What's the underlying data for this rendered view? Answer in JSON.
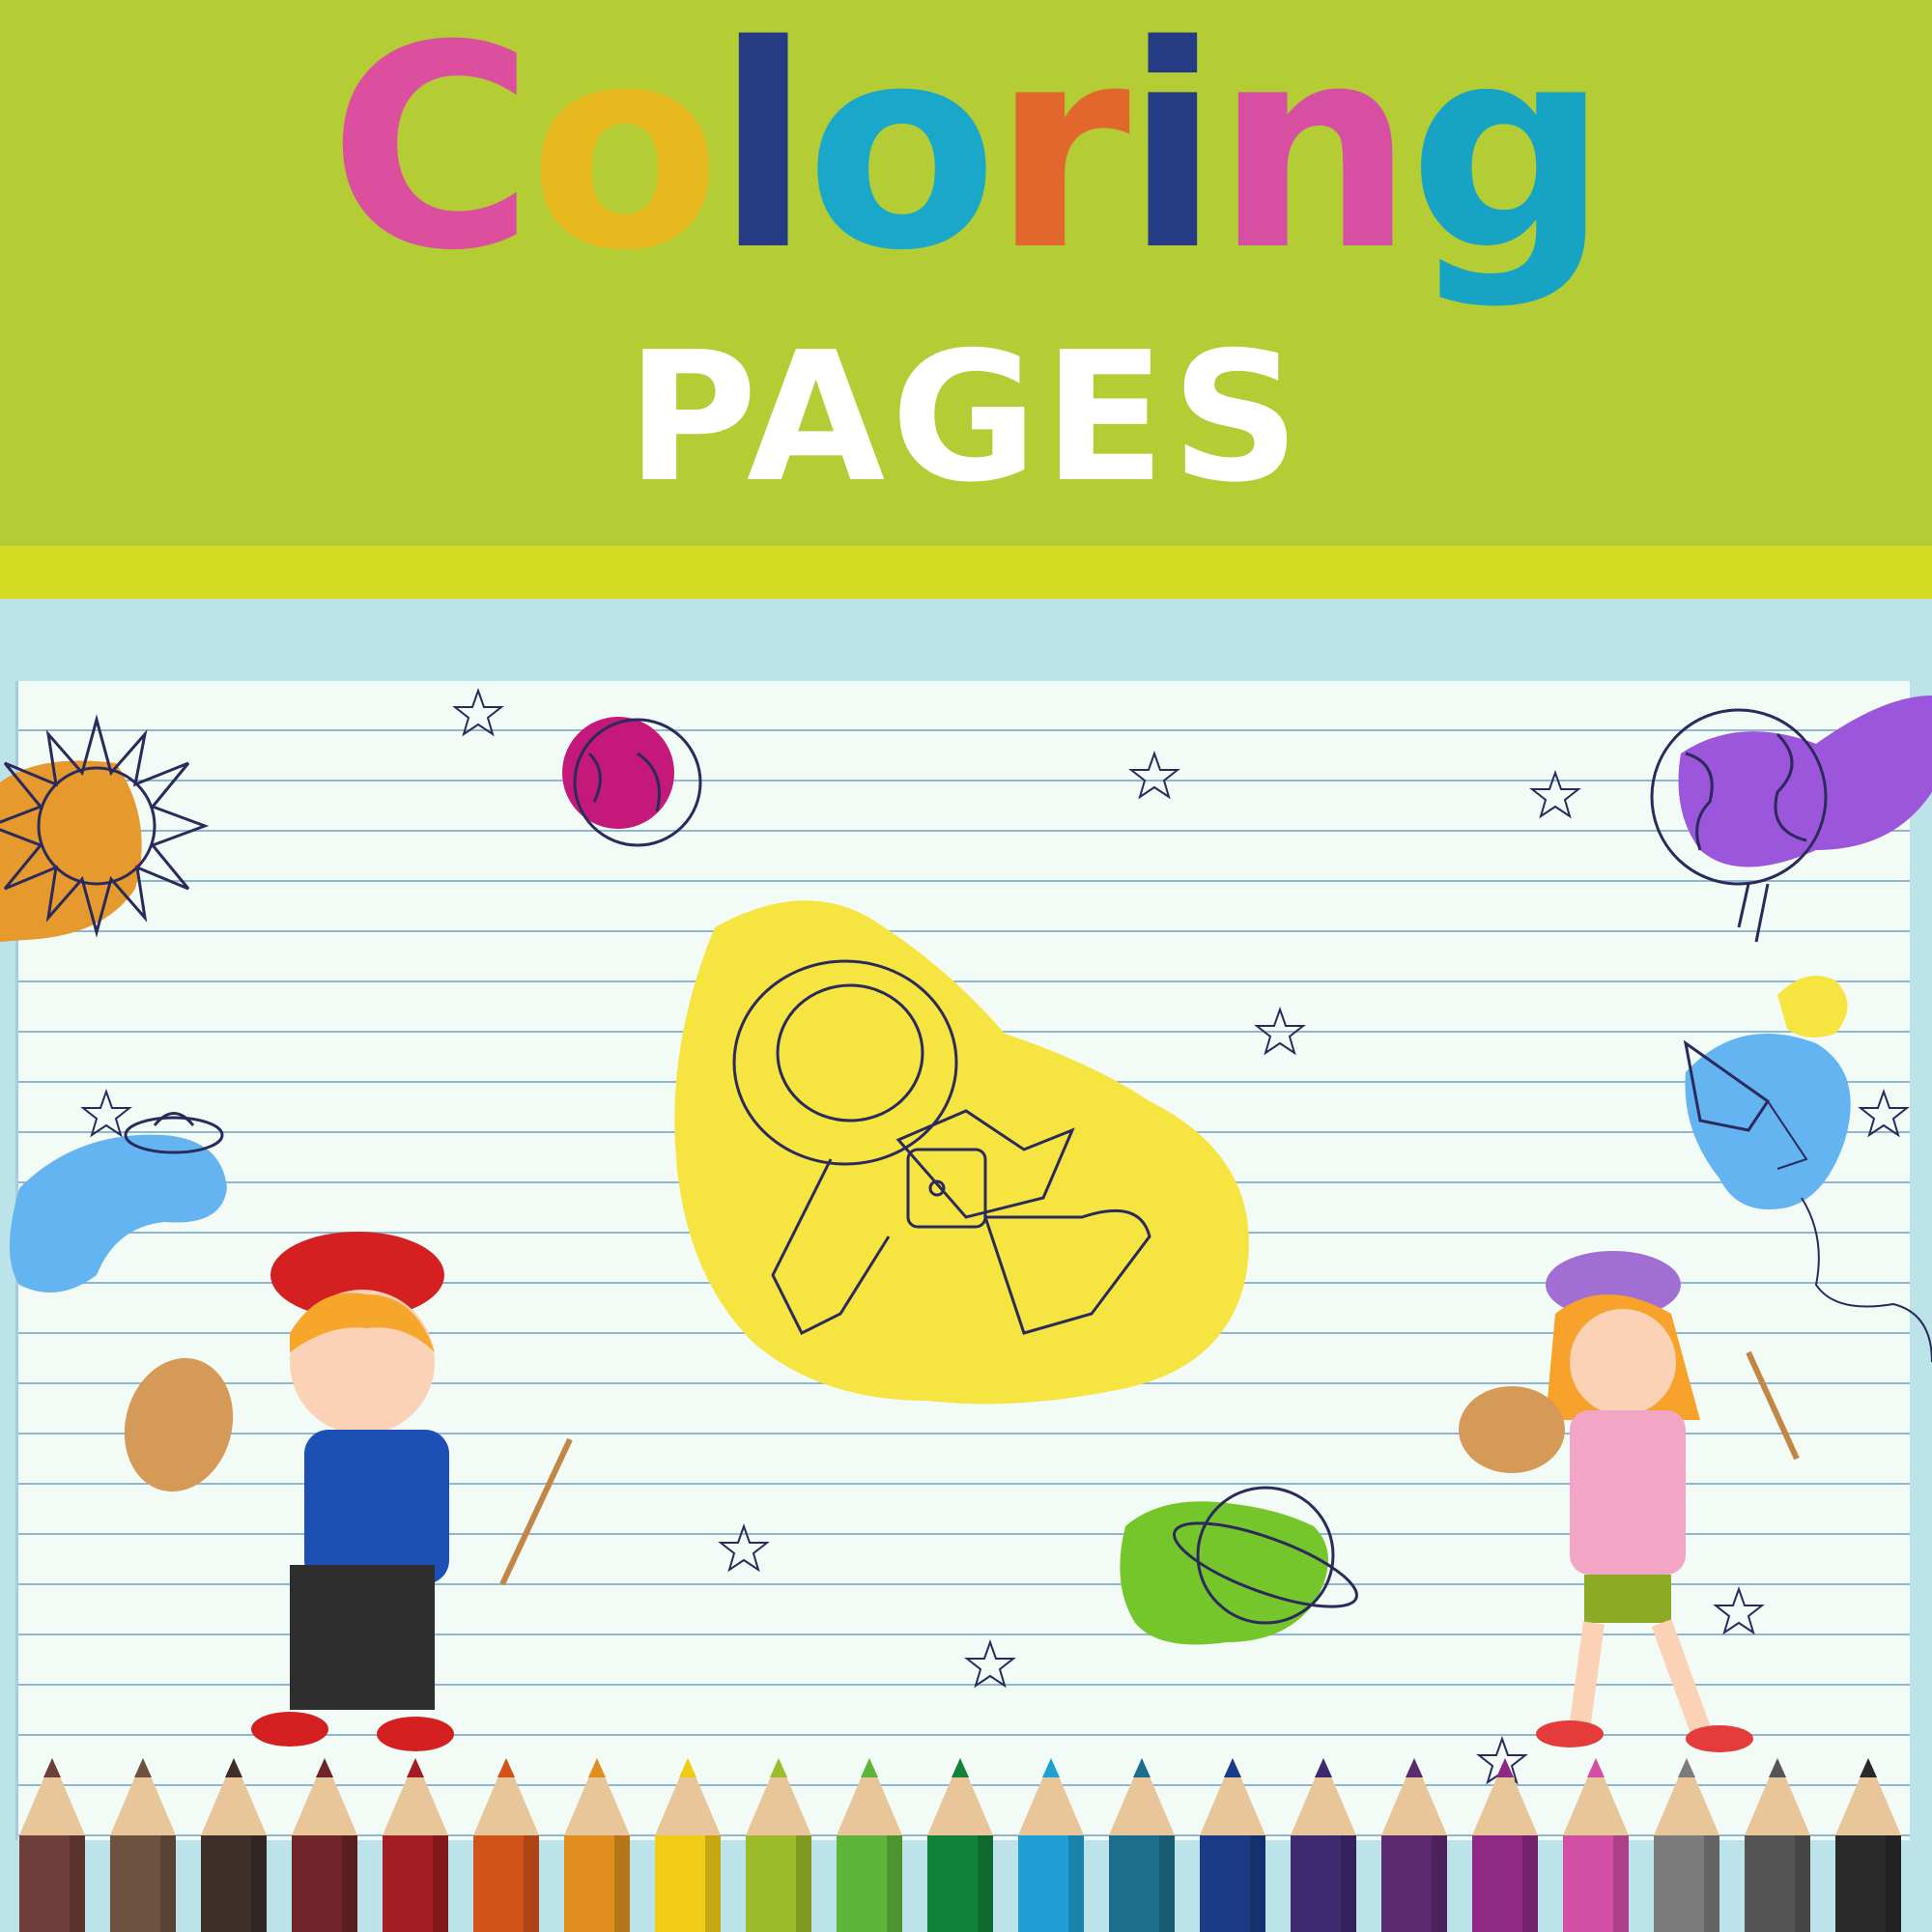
{
  "title": {
    "text": "Coloring",
    "letters": [
      {
        "char": "C",
        "color": "#dc4f9e"
      },
      {
        "char": "o",
        "color": "#e8b91f"
      },
      {
        "char": "l",
        "color": "#253c84"
      },
      {
        "char": "o",
        "color": "#19a8c9"
      },
      {
        "char": "r",
        "color": "#e2672c"
      },
      {
        "char": "i",
        "color": "#253c84"
      },
      {
        "char": "n",
        "color": "#d64fa3"
      },
      {
        "char": "g",
        "color": "#17a3c4"
      }
    ]
  },
  "subtitle": "PAGES",
  "colors": {
    "header_bg": "#b4cd34",
    "stripe": "#d6dc24",
    "frame": "#bde3ea",
    "paper": "#f2fbf5"
  },
  "pencil_colors": [
    "#6e3f3a",
    "#6d5240",
    "#3e2f2a",
    "#6e2428",
    "#a11f24",
    "#d2531a",
    "#e08f1f",
    "#f1cc16",
    "#9dbb2a",
    "#5fb53a",
    "#12823a",
    "#1f9fd3",
    "#1b6f8c",
    "#1c3b86",
    "#3d2a6f",
    "#5c2a70",
    "#8e2a84",
    "#d34fa4",
    "#7b7b7b",
    "#555555",
    "#2a2a2a"
  ],
  "illustrations": [
    "sun",
    "magenta-planet",
    "earth",
    "astronaut",
    "ufo",
    "rocket",
    "saturn",
    "boy-painter",
    "girl-painter",
    "stars"
  ]
}
